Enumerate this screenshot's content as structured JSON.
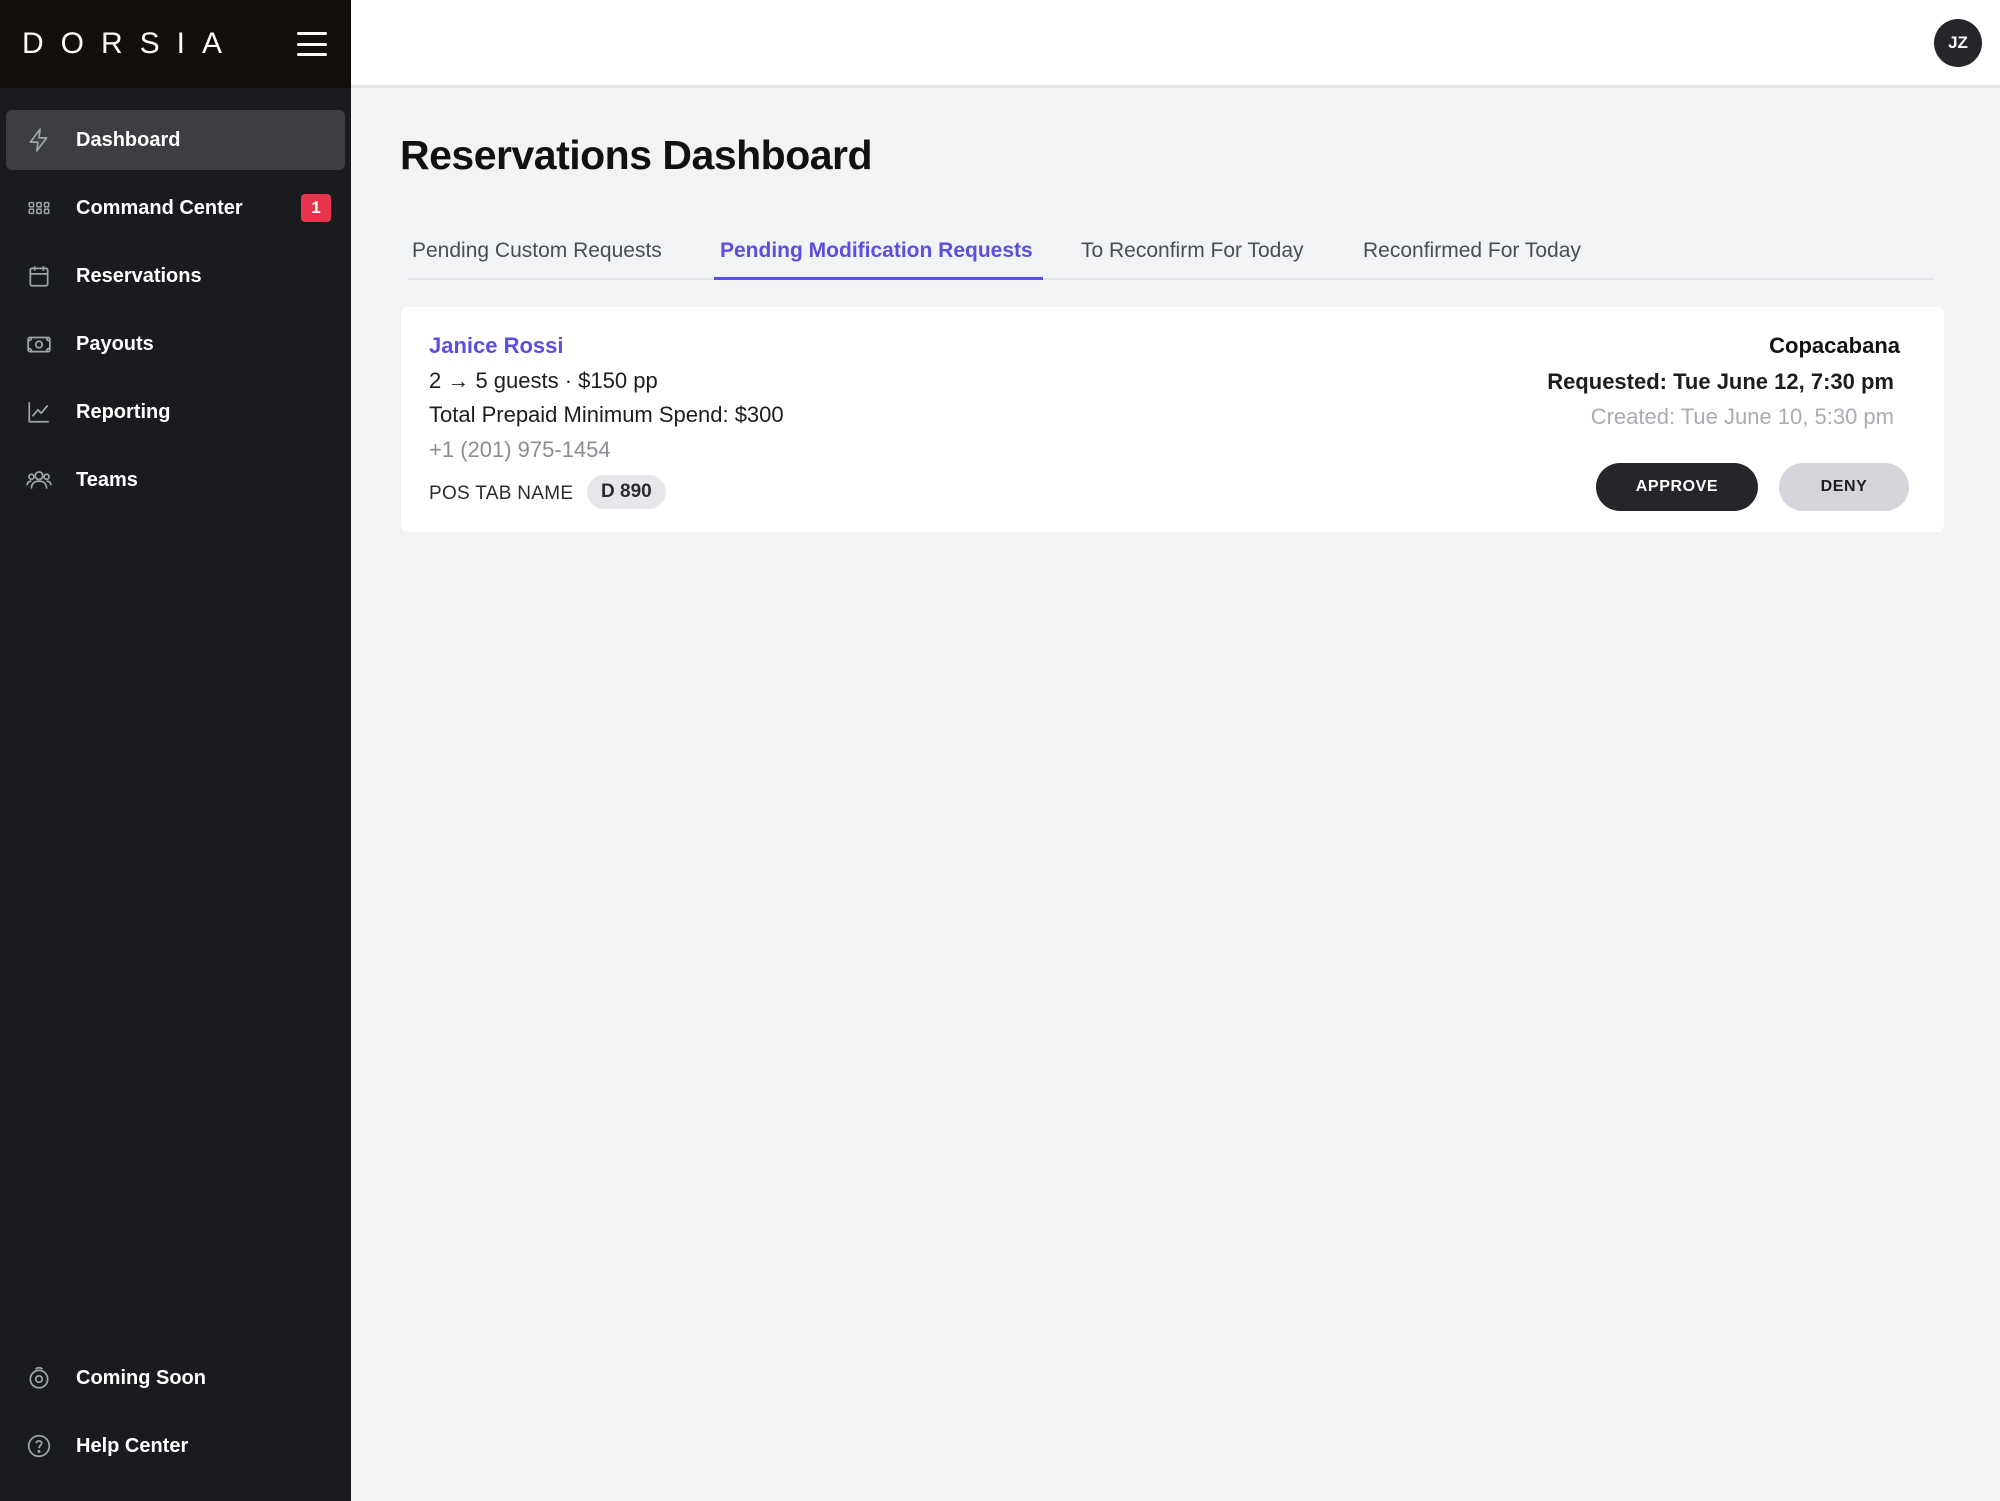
{
  "app": {
    "logo": "DORSIA",
    "user_initials": "JZ"
  },
  "sidebar": {
    "items": [
      {
        "label": "Dashboard",
        "icon": "lightning-icon",
        "active": true
      },
      {
        "label": "Command Center",
        "icon": "grid-icon",
        "badge": "1"
      },
      {
        "label": "Reservations",
        "icon": "calendar-icon"
      },
      {
        "label": "Payouts",
        "icon": "cash-icon"
      },
      {
        "label": "Reporting",
        "icon": "chart-line-icon"
      },
      {
        "label": "Teams",
        "icon": "people-icon"
      }
    ],
    "bottom_items": [
      {
        "label": "Coming Soon",
        "icon": "sparkle-icon"
      },
      {
        "label": "Help Center",
        "icon": "question-circle-icon"
      }
    ]
  },
  "main": {
    "title": "Reservations Dashboard",
    "tabs": [
      {
        "label": "Pending Custom Requests",
        "active": false
      },
      {
        "label": "Pending Modification Requests",
        "active": true
      },
      {
        "label": "To Reconfirm For Today",
        "active": false
      },
      {
        "label": "Reconfirmed For Today",
        "active": false
      }
    ],
    "requests": [
      {
        "guest_name": "Janice Rossi",
        "guests_line": "2 → 5 guests · $150 pp",
        "spend_line": "Total Prepaid Minimum Spend: $300",
        "phone": "+1 (201) 975-1454",
        "pos_label": "POS TAB NAME",
        "pos_value": "D 890",
        "venue": "Copacabana",
        "requested": "Requested: Tue June 12, 7:30 pm",
        "created": "Created: Tue June 10, 5:30 pm",
        "approve_label": "APPROVE",
        "deny_label": "DENY"
      }
    ]
  },
  "colors": {
    "accent": "#5b4fe0",
    "sidebar_bg": "#191b1f",
    "badge": "#e8344f"
  }
}
